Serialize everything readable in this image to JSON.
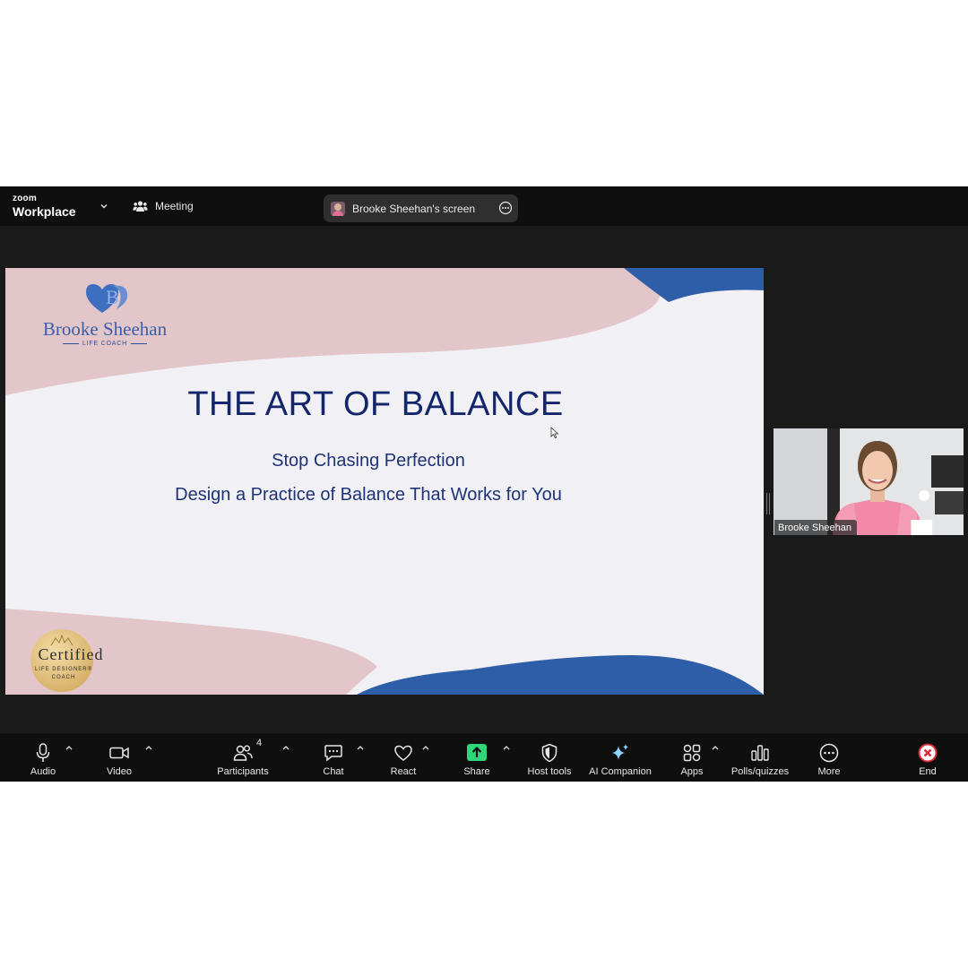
{
  "app": {
    "brand_small": "zoom",
    "brand_big": "Workplace",
    "meeting_label": "Meeting",
    "shared_screen_label": "Brooke Sheehan's screen"
  },
  "slide": {
    "logo_name": "Brooke Sheehan",
    "logo_sub": "LIFE COACH",
    "title": "THE ART OF BALANCE",
    "subtitle1": "Stop Chasing Perfection",
    "subtitle2": "Design a Practice of Balance That Works for You",
    "badge_title": "Certified",
    "badge_sub1": "LIFE DESIGNER®",
    "badge_sub2": "COACH",
    "colors": {
      "pink": "#e3c6c9",
      "blue": "#2f5ea8",
      "title": "#13266b"
    }
  },
  "participant": {
    "name": "Brooke Sheehan"
  },
  "toolbar": {
    "audio": "Audio",
    "video": "Video",
    "participants": "Participants",
    "participants_count": "4",
    "chat": "Chat",
    "react": "React",
    "share": "Share",
    "host_tools": "Host tools",
    "ai_companion": "AI Companion",
    "apps": "Apps",
    "polls": "Polls/quizzes",
    "more": "More",
    "end": "End"
  },
  "icons": {
    "audio": "microphone-icon",
    "video": "video-camera-icon",
    "participants": "people-icon",
    "chat": "chat-bubble-icon",
    "react": "heart-icon",
    "share": "share-arrow-icon",
    "host_tools": "shield-icon",
    "ai_companion": "sparkle-icon",
    "apps": "apps-icon",
    "polls": "bar-chart-icon",
    "more": "more-dots-icon",
    "end": "end-x-icon"
  }
}
